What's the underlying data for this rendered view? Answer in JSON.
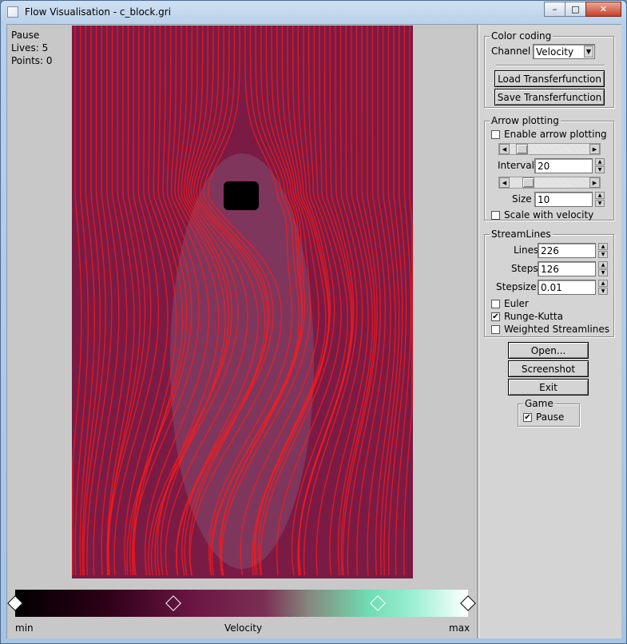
{
  "window": {
    "title": "Flow Visualisation - c_block.gri",
    "minimize_glyph": "–",
    "maximize_glyph": "□",
    "close_glyph": "✕"
  },
  "status": {
    "state": "Pause",
    "lives": "Lives: 5",
    "points": "Points: 0"
  },
  "transfer_function": {
    "min_label": "min",
    "center_label": "Velocity",
    "max_label": "max",
    "gradient_colors": [
      "#000000",
      "#2e0018",
      "#6c1744",
      "#7b2f54",
      "#85897f",
      "#6fdcb2",
      "#9cf0d4",
      "#ffffff"
    ],
    "marker_positions": [
      0.0,
      0.35,
      0.8,
      1.0
    ]
  },
  "colors": {
    "flow_background": "#7a1b45",
    "streamline": "#ff1a1a",
    "panel_background": "#d4d4d4"
  },
  "color_coding": {
    "title": "Color coding",
    "channel_label": "Channel",
    "channel_value": "Velocity",
    "load_button": "Load Transferfunction",
    "save_button": "Save Transferfunction"
  },
  "arrow_plotting": {
    "title": "Arrow plotting",
    "enable_label": "Enable arrow plotting",
    "enable_checked": false,
    "interval_label": "Interval",
    "interval_value": "20",
    "size_label": "Size",
    "size_value": "10",
    "scale_label": "Scale with velocity",
    "scale_checked": false
  },
  "streamlines": {
    "title": "StreamLines",
    "lines_label": "Lines",
    "lines_value": "226",
    "steps_label": "Steps",
    "steps_value": "126",
    "stepsize_label": "Stepsize",
    "stepsize_value": "0.01",
    "euler_label": "Euler",
    "euler_checked": false,
    "rk_label": "Runge-Kutta",
    "rk_checked": true,
    "weighted_label": "Weighted Streamlines",
    "weighted_checked": false
  },
  "actions": {
    "open": "Open...",
    "screenshot": "Screenshot",
    "exit": "Exit"
  },
  "game": {
    "title": "Game",
    "pause_label": "Pause",
    "pause_checked": true
  },
  "check_glyph": "✔"
}
